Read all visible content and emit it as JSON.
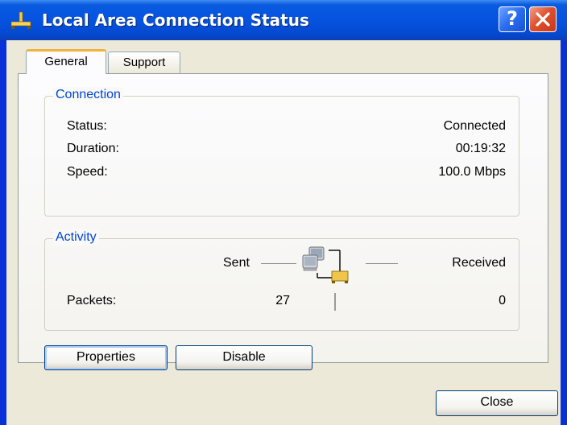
{
  "window": {
    "title": "Local Area Connection Status",
    "help_button": "?",
    "icon": "network-connection-icon",
    "close_icon": "close-icon"
  },
  "tabs": [
    {
      "label": "General",
      "selected": true
    },
    {
      "label": "Support",
      "selected": false
    }
  ],
  "connection": {
    "group_label": "Connection",
    "rows": [
      {
        "label": "Status:",
        "value": "Connected"
      },
      {
        "label": "Duration:",
        "value": "00:19:32"
      },
      {
        "label": "Speed:",
        "value": "100.0 Mbps"
      }
    ]
  },
  "activity": {
    "group_label": "Activity",
    "sent_label": "Sent",
    "received_label": "Received",
    "packets_label": "Packets:",
    "packets_sent": "27",
    "packets_received": "0",
    "icon": "network-activity-icon"
  },
  "buttons": {
    "properties": "Properties",
    "disable": "Disable",
    "close": "Close"
  },
  "colors": {
    "title_bar": "#0553e0",
    "group_title": "#0046d5",
    "dialog_bg": "#ece9d8",
    "close_button": "#e0512e",
    "tab_highlight": "#f0b33c"
  }
}
